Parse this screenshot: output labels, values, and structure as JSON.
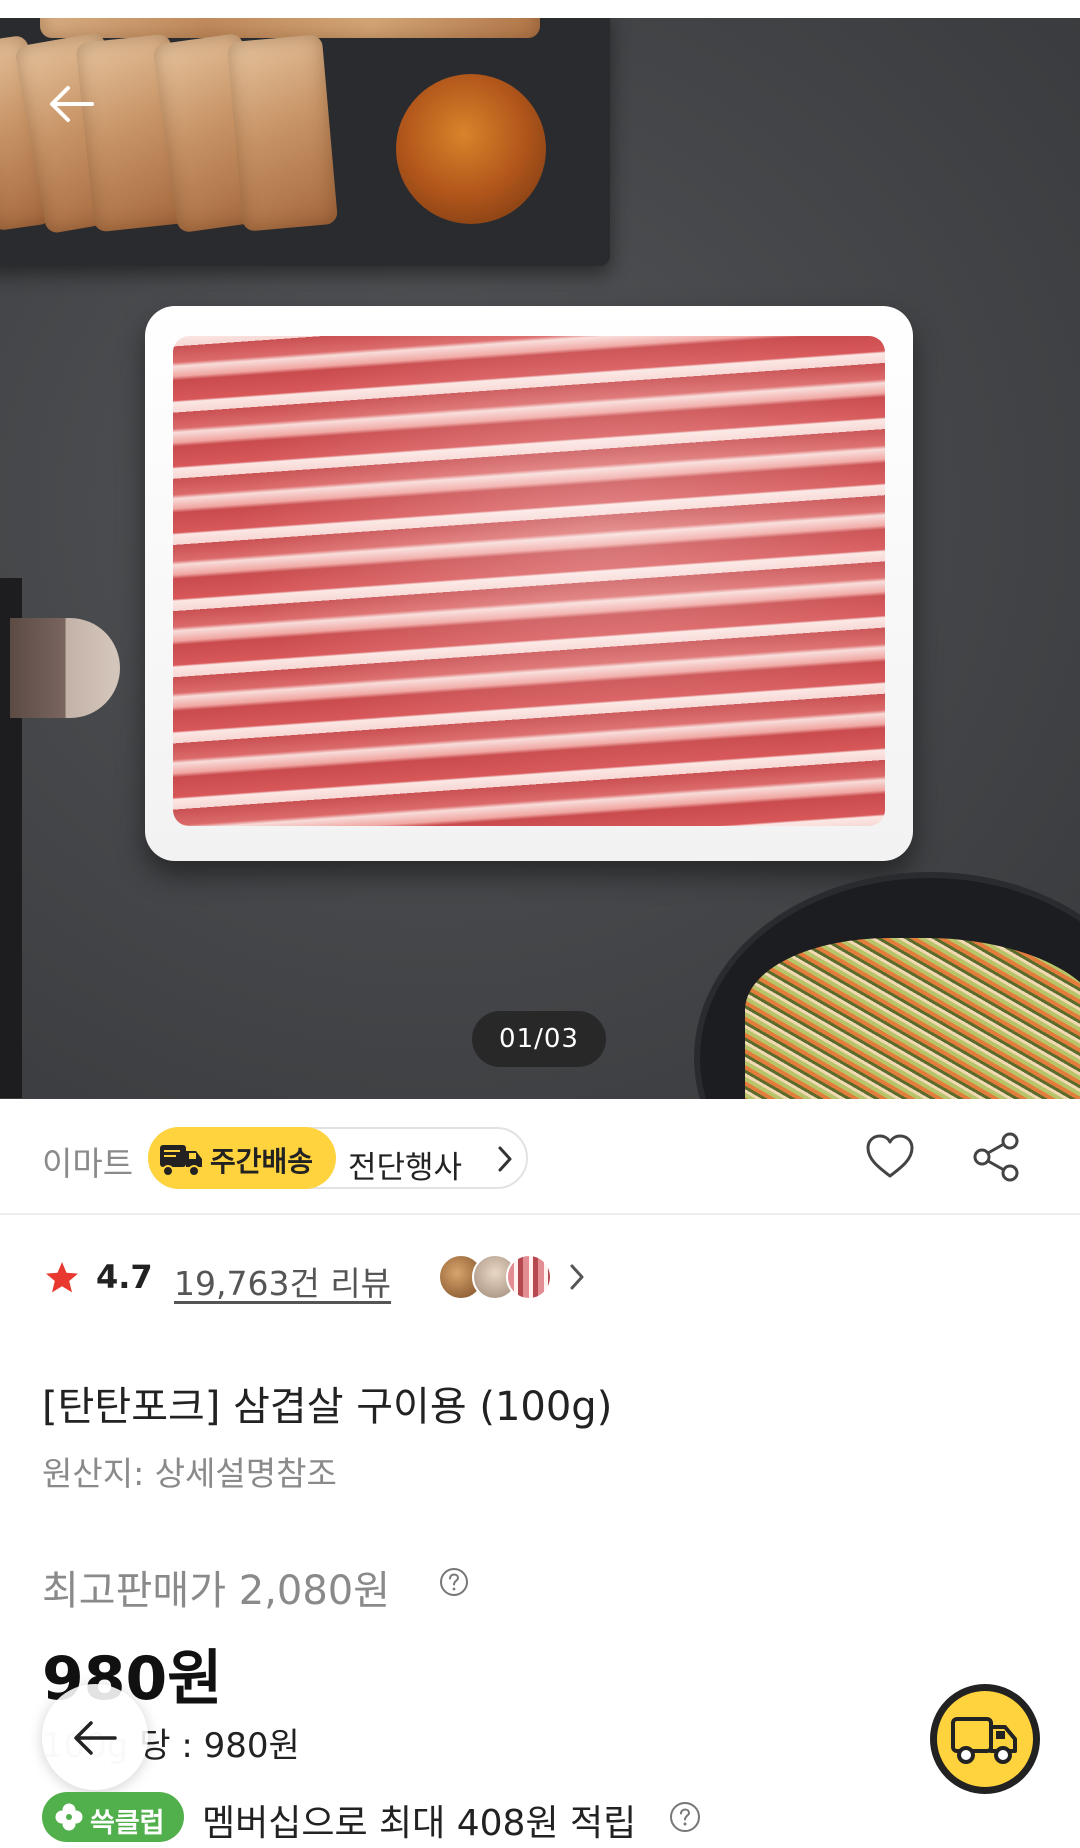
{
  "hero": {
    "page_indicator": "01/03",
    "back_icon": "arrow-left-icon"
  },
  "store": {
    "name": "이마트",
    "delivery_badge": "주간배송",
    "event_label": "전단행사",
    "icons": [
      "truck-icon",
      "chevron-right-icon",
      "heart-icon",
      "share-icon"
    ],
    "accent_color": "#ffd33d"
  },
  "rating": {
    "score": "4.7",
    "review_count": "19,763건 리뷰",
    "star_color": "#e8382f"
  },
  "product": {
    "title": "[탄탄포크] 삼겹살 구이용 (100g)",
    "origin": "원산지: 상세설명참조",
    "original_price": "최고판매가 2,080원",
    "sale_price": "980원",
    "unit_price_faded": "100g",
    "unit_price": "당 : 980원"
  },
  "membership": {
    "badge": "쓱클럽",
    "text": "멤버십으로 최대 408원 적립",
    "badge_color": "#52b04c"
  }
}
